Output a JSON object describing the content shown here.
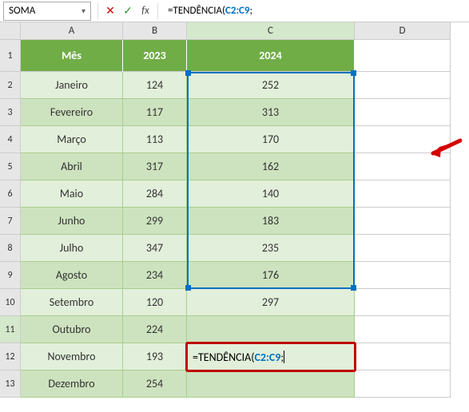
{
  "nameBox": {
    "value": "SOMA"
  },
  "formulaBar": {
    "cancelGlyph": "✕",
    "acceptGlyph": "✓",
    "fxLabel": "fx",
    "formula_prefix": "=",
    "formula_fn": "TENDÊNCIA(",
    "formula_ref": "C2:C9",
    "formula_suffix": ";"
  },
  "columns": [
    "A",
    "B",
    "C",
    "D"
  ],
  "rowNumbers": [
    1,
    2,
    3,
    4,
    5,
    6,
    7,
    8,
    9,
    10,
    11,
    12,
    13
  ],
  "headers": {
    "mes": "Mês",
    "y2023": "2023",
    "y2024": "2024"
  },
  "rows": [
    {
      "mes": "Janeiro",
      "y2023": "124",
      "y2024": "252"
    },
    {
      "mes": "Fevereiro",
      "y2023": "117",
      "y2024": "313"
    },
    {
      "mes": "Março",
      "y2023": "113",
      "y2024": "170"
    },
    {
      "mes": "Abril",
      "y2023": "317",
      "y2024": "162"
    },
    {
      "mes": "Maio",
      "y2023": "284",
      "y2024": "140"
    },
    {
      "mes": "Junho",
      "y2023": "299",
      "y2024": "183"
    },
    {
      "mes": "Julho",
      "y2023": "347",
      "y2024": "235"
    },
    {
      "mes": "Agosto",
      "y2023": "234",
      "y2024": "176"
    },
    {
      "mes": "Setembro",
      "y2023": "120",
      "y2024": "297"
    },
    {
      "mes": "Outubro",
      "y2023": "224",
      "y2024": ""
    },
    {
      "mes": "Novembro",
      "y2023": "193",
      "y2024": ""
    },
    {
      "mes": "Dezembro",
      "y2023": "254",
      "y2024": ""
    }
  ],
  "editingCell": {
    "formula_prefix": "=",
    "formula_fn": "TENDÊNCIA(",
    "formula_ref": "C2:C9",
    "formula_suffix": ";"
  },
  "chart_data": {
    "type": "table",
    "title": "",
    "categories": [
      "Janeiro",
      "Fevereiro",
      "Março",
      "Abril",
      "Maio",
      "Junho",
      "Julho",
      "Agosto",
      "Setembro",
      "Outubro",
      "Novembro",
      "Dezembro"
    ],
    "series": [
      {
        "name": "2023",
        "values": [
          124,
          117,
          113,
          317,
          284,
          299,
          347,
          234,
          120,
          224,
          193,
          254
        ]
      },
      {
        "name": "2024",
        "values": [
          252,
          313,
          170,
          162,
          140,
          183,
          235,
          176,
          297,
          null,
          null,
          null
        ]
      }
    ]
  }
}
